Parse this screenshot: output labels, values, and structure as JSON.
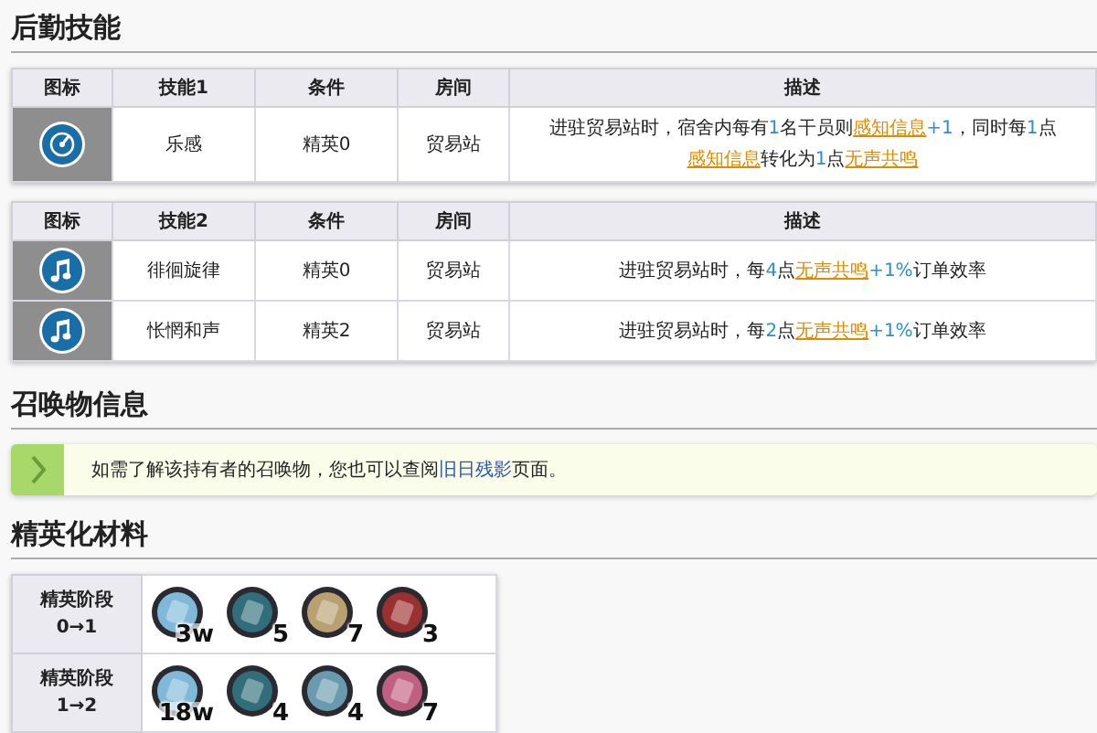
{
  "sections": [
    {
      "kind": "skills",
      "title": "后勤技能",
      "tables": [
        {
          "columns": [
            "图标",
            "技能1",
            "条件",
            "房间",
            "描述"
          ],
          "rows": [
            {
              "name": "乐感",
              "condition": "精英0",
              "room": "贸易站",
              "description": [
                {
                  "kind": "plain",
                  "text": "进驻贸易站时，宿舍内每有"
                },
                {
                  "kind": "num",
                  "text": "1"
                },
                {
                  "kind": "plain",
                  "text": "名干员则"
                },
                {
                  "kind": "link",
                  "text": "感知信息"
                },
                {
                  "kind": "num",
                  "text": "+1"
                },
                {
                  "kind": "plain",
                  "text": "，同时每"
                },
                {
                  "kind": "num",
                  "text": "1"
                },
                {
                  "kind": "plain",
                  "text": "点"
                },
                {
                  "kind": "link",
                  "text": "感知信息"
                },
                {
                  "kind": "plain",
                  "text": "转化为"
                },
                {
                  "kind": "num",
                  "text": "1"
                },
                {
                  "kind": "plain",
                  "text": "点"
                },
                {
                  "kind": "link",
                  "text": "无声共鸣"
                }
              ]
            }
          ]
        },
        {
          "columns": [
            "图标",
            "技能2",
            "条件",
            "房间",
            "描述"
          ],
          "rows": [
            {
              "name": "徘徊旋律",
              "condition": "精英0",
              "room": "贸易站",
              "description": [
                {
                  "kind": "plain",
                  "text": "进驻贸易站时，每"
                },
                {
                  "kind": "num",
                  "text": "4"
                },
                {
                  "kind": "plain",
                  "text": "点"
                },
                {
                  "kind": "link",
                  "text": "无声共鸣"
                },
                {
                  "kind": "num",
                  "text": "+1%"
                },
                {
                  "kind": "plain",
                  "text": "订单效率"
                }
              ]
            },
            {
              "name": "怅惘和声",
              "condition": "精英2",
              "room": "贸易站",
              "description": [
                {
                  "kind": "plain",
                  "text": "进驻贸易站时，每"
                },
                {
                  "kind": "num",
                  "text": "2"
                },
                {
                  "kind": "plain",
                  "text": "点"
                },
                {
                  "kind": "link",
                  "text": "无声共鸣"
                },
                {
                  "kind": "num",
                  "text": "+1%"
                },
                {
                  "kind": "plain",
                  "text": "订单效率"
                }
              ]
            }
          ]
        }
      ]
    },
    {
      "kind": "notice",
      "title": "召唤物信息",
      "message": [
        {
          "kind": "plain",
          "text": "如需了解该持有者的召唤物，您也可以查阅"
        },
        {
          "kind": "link",
          "text": "旧日残影"
        },
        {
          "kind": "plain",
          "text": "页面。"
        }
      ]
    },
    {
      "kind": "materials",
      "title": "精英化材料",
      "stages": [
        {
          "label": "精英阶段",
          "range": "0→1",
          "items": [
            {
              "count": "3w"
            },
            {
              "count": "5"
            },
            {
              "count": "7"
            },
            {
              "count": "3"
            }
          ]
        },
        {
          "label": "精英阶段",
          "range": "1→2",
          "items": [
            {
              "count": "18w"
            },
            {
              "count": "4"
            },
            {
              "count": "4"
            },
            {
              "count": "7"
            }
          ]
        }
      ]
    }
  ]
}
